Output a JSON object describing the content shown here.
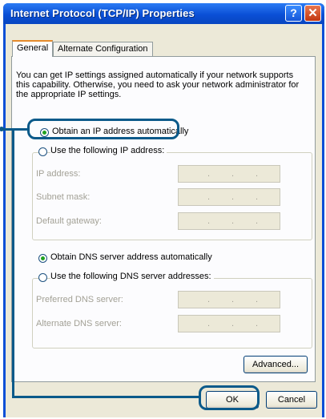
{
  "window": {
    "title": "Internet Protocol (TCP/IP) Properties",
    "help_glyph": "?",
    "close_glyph": "✕"
  },
  "tabs": [
    {
      "label": "General",
      "active": true
    },
    {
      "label": "Alternate Configuration",
      "active": false
    }
  ],
  "intro_text": "You can get IP settings assigned automatically if your network supports this capability. Otherwise, you need to ask your network administrator for the appropriate IP settings.",
  "ip_options": {
    "auto_label": "Obtain an IP address automatically",
    "auto_selected": true,
    "manual_label": "Use the following IP address:",
    "manual_selected": false
  },
  "ip_fields": [
    {
      "label": "IP address:",
      "value": ". . ."
    },
    {
      "label": "Subnet mask:",
      "value": ". . ."
    },
    {
      "label": "Default gateway:",
      "value": ". . ."
    }
  ],
  "dns_options": {
    "auto_label": "Obtain DNS server address automatically",
    "auto_selected": true,
    "manual_label": "Use the following DNS server addresses:",
    "manual_selected": false
  },
  "dns_fields": [
    {
      "label": "Preferred DNS server:",
      "value": ". . ."
    },
    {
      "label": "Alternate DNS server:",
      "value": ". . ."
    }
  ],
  "buttons": {
    "advanced": "Advanced...",
    "ok": "OK",
    "cancel": "Cancel"
  },
  "colors": {
    "titlebar": "#0a4fd6",
    "dialog_bg": "#ece9d8",
    "callout": "#0b5a8a",
    "radio_dot": "#21a121"
  }
}
